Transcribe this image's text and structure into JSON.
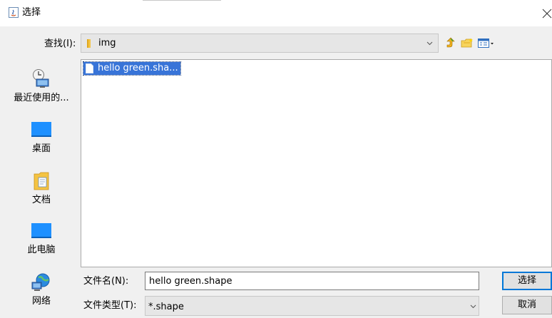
{
  "window": {
    "title": "选择"
  },
  "lookin": {
    "label": "查找(I):",
    "value": "img"
  },
  "places": [
    {
      "label": "最近使用的...",
      "icon": "recent-icon"
    },
    {
      "label": "桌面",
      "icon": "desktop-icon"
    },
    {
      "label": "文档",
      "icon": "documents-icon"
    },
    {
      "label": "此电脑",
      "icon": "this-pc-icon"
    },
    {
      "label": "网络",
      "icon": "network-icon"
    }
  ],
  "files": [
    {
      "name": "hello green.sha...",
      "selected": true
    }
  ],
  "filename": {
    "label": "文件名(N):",
    "value": "hello green.shape"
  },
  "filetype": {
    "label": "文件类型(T):",
    "value": "*.shape"
  },
  "buttons": {
    "open": "选择",
    "cancel": "取消"
  },
  "colors": {
    "selection": "#3874d8",
    "accent": "#0078d7",
    "desktop_blue": "#1e90ff",
    "folder_yellow": "#f4c342"
  }
}
